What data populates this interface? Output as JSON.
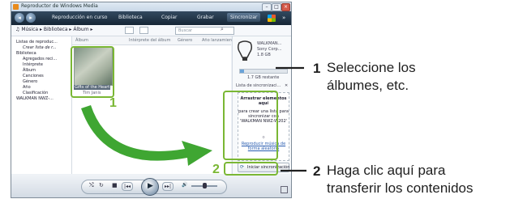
{
  "window": {
    "title": "Reproductor de Windows Media",
    "min_label": "–",
    "max_label": "□",
    "close_label": "×"
  },
  "tabs": [
    "Reproducción en curso",
    "Biblioteca",
    "Copiar",
    "Grabar",
    "Sincronizar"
  ],
  "toolbar": {
    "breadcrumb": "Música ▸ Biblioteca ▸ Álbum ▸",
    "search_placeholder": "Buscar"
  },
  "nav": {
    "items": [
      "Listas de reproduc...",
      "Crear lista de r...",
      "Biblioteca",
      "Agregados reci...",
      "Intérprete",
      "Álbum",
      "Canciones",
      "Género",
      "Año",
      "Clasificación",
      "WALKMAN NWZ-..."
    ]
  },
  "columns": [
    "Álbum",
    "Intérprete del álbum",
    "Género",
    "Año lanzamiento"
  ],
  "album": {
    "title": "Gifts of the Heart",
    "artist": "Tim Janis"
  },
  "device": {
    "name": "WALKMAN...",
    "maker": "Sony Corp...",
    "capacity": "1.8 GB",
    "remaining": "1.7 GB restante"
  },
  "sync_panel": {
    "list_label": "Lista de sincronizaci...",
    "close_label": "✕",
    "drag_title": "Arrastrar elementos aquí",
    "drag_body": "para crear una lista para sincronizar con 'WALKMAN NWZ-W202'",
    "or_label": "o",
    "shuffle_link": "Reproducir música de forma aleatoria",
    "start_sync": "Iniciar sincronización"
  },
  "player": {
    "shuffle": "⤭",
    "repeat": "↻",
    "stop": "■",
    "prev": "|◂◂",
    "play": "▶",
    "next": "▸▸|",
    "volume": "🔊"
  },
  "annotations": {
    "step1_num": "1",
    "step2_num": "2",
    "callout1_num": "1",
    "callout1_line1": "Seleccione los",
    "callout1_line2": "álbumes, etc.",
    "callout2_num": "2",
    "callout2_line1": "Haga clic aquí para",
    "callout2_line2": "transferir los contenidos"
  },
  "colors": {
    "highlight_green": "#7ab734",
    "arrow_green": "#3fa632",
    "tabbar_dark": "#1c2e40"
  }
}
